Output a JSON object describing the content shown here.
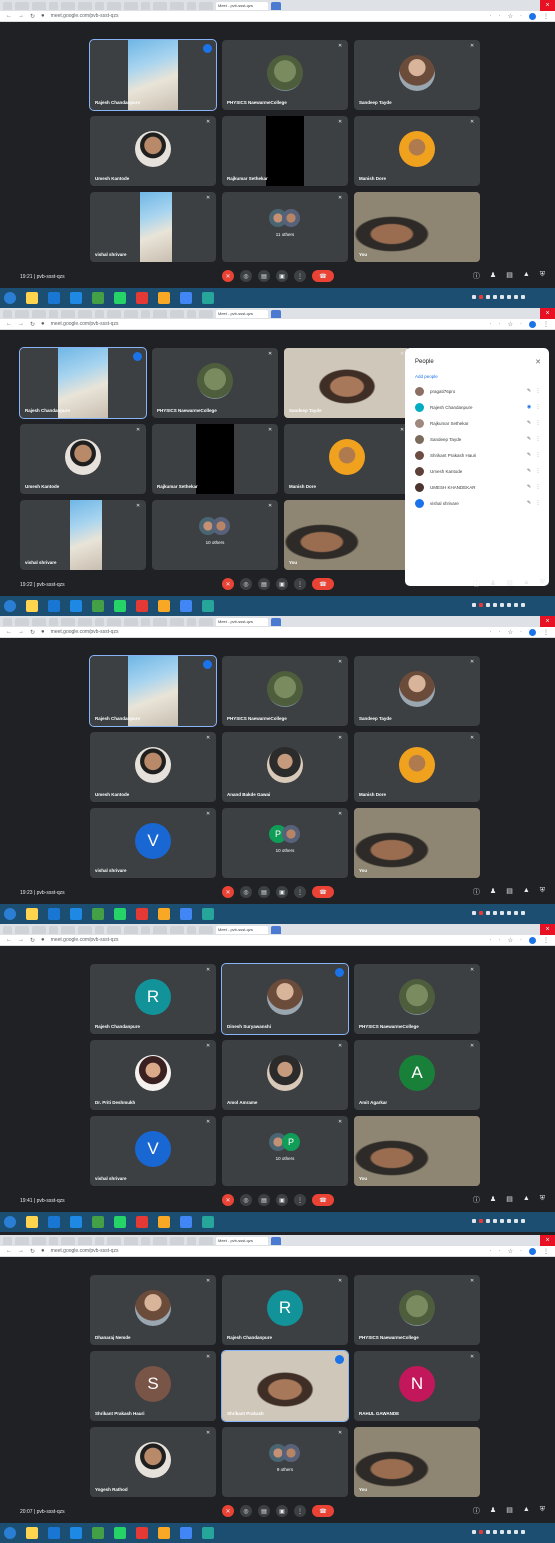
{
  "frames": [
    {
      "time_label": "19:21 | pvb-ssst-qzs",
      "tiles": [
        {
          "name": "Rajesh Chandanpure",
          "kind": "self"
        },
        {
          "name": "PHYSICS NaewarmeCollege",
          "kind": "tree"
        },
        {
          "name": "Sandeep Tayde",
          "kind": "photo"
        },
        {
          "name": "Umesh Kantode",
          "kind": "glasses"
        },
        {
          "name": "Rajkumar Sethekar",
          "kind": "black"
        },
        {
          "name": "Manish Dore",
          "kind": "orange"
        },
        {
          "name": "vishal shrivare",
          "kind": "face"
        },
        {
          "name": "11 others",
          "kind": "others"
        },
        {
          "name": "You",
          "kind": "pin"
        }
      ]
    },
    {
      "time_label": "19:22 | pvb-ssst-qzs",
      "tiles": [
        {
          "name": "Rajesh Chandanpure",
          "kind": "self"
        },
        {
          "name": "PHYSICS NaewarmeCollege",
          "kind": "tree"
        },
        {
          "name": "Sandeep Tayde",
          "kind": "face"
        },
        {
          "name": "Umesh Kantode",
          "kind": "glasses"
        },
        {
          "name": "Rajkumar Sethekar",
          "kind": "black"
        },
        {
          "name": "Manish Dore",
          "kind": "orange"
        },
        {
          "name": "vishal shrivare",
          "kind": "face"
        },
        {
          "name": "10 others",
          "kind": "others"
        },
        {
          "name": "You",
          "kind": "pin"
        }
      ],
      "people_panel": {
        "title": "People",
        "add_label": "Add people",
        "people": [
          {
            "name": "pragati76pro",
            "color": "#8d6e63"
          },
          {
            "name": "Rajesh Chandanpure",
            "color": "#00acc1"
          },
          {
            "name": "Rajkumar Sethekar",
            "color": "#a1887f"
          },
          {
            "name": "Sandeep Tayde",
            "color": "#7b6b5a"
          },
          {
            "name": "Shrikant Prakash Hauri",
            "color": "#6d4c41"
          },
          {
            "name": "Umesh Kantode",
            "color": "#5d4037"
          },
          {
            "name": "UMESH KHANDEKAR",
            "color": "#4e342e"
          },
          {
            "name": "vishal shrivare",
            "color": "#1a73e8"
          }
        ]
      }
    },
    {
      "time_label": "19:23 | pvb-ssst-qzs",
      "tiles": [
        {
          "name": "Rajesh Chandanpure",
          "kind": "self"
        },
        {
          "name": "PHYSICS NaewarmeCollege",
          "kind": "tree"
        },
        {
          "name": "Sandeep Tayde",
          "kind": "photo"
        },
        {
          "name": "Umesh Kantode",
          "kind": "glasses"
        },
        {
          "name": "Anand Bakde Gawai",
          "kind": "person2"
        },
        {
          "name": "Manish Dore",
          "kind": "orange"
        },
        {
          "name": "vishal shrivare",
          "kind": "letter",
          "letter": "V",
          "color": "#1967d2"
        },
        {
          "name": "10 others",
          "kind": "others",
          "first_letter": "P"
        },
        {
          "name": "You",
          "kind": "pin"
        }
      ]
    },
    {
      "time_label": "19:41 | pvb-ssst-qzs",
      "tiles": [
        {
          "name": "Rajesh Chandanpure",
          "kind": "letter",
          "letter": "R",
          "color": "#12939a"
        },
        {
          "name": "Dinesh Suryawanshi",
          "kind": "photo",
          "highlight": true
        },
        {
          "name": "PHYSICS NaewarmeCollege",
          "kind": "tree"
        },
        {
          "name": "Dr. Priti Deshmukh",
          "kind": "lady"
        },
        {
          "name": "Amol Amrame",
          "kind": "person2"
        },
        {
          "name": "Amit Agarkar",
          "kind": "letter",
          "letter": "A",
          "color": "#188038"
        },
        {
          "name": "vishal shrivare",
          "kind": "letter",
          "letter": "V",
          "color": "#1967d2"
        },
        {
          "name": "10 others",
          "kind": "others",
          "second_letter": "P"
        },
        {
          "name": "You",
          "kind": "pin"
        }
      ]
    },
    {
      "time_label": "20:07 | pvb-ssst-qzs",
      "tiles": [
        {
          "name": "Dhanaraj Nemde",
          "kind": "photo"
        },
        {
          "name": "Rajesh Chandanpure",
          "kind": "letter",
          "letter": "R",
          "color": "#12939a"
        },
        {
          "name": "PHYSICS NaewarmeCollege",
          "kind": "tree"
        },
        {
          "name": "Shrikant Prakash Hauri",
          "kind": "letter",
          "letter": "S",
          "color": "#795548"
        },
        {
          "name": "Shrikant Prakash",
          "kind": "face",
          "highlight": true
        },
        {
          "name": "RAHUL GAWANDE",
          "kind": "letter",
          "letter": "N",
          "color": "#c2185b"
        },
        {
          "name": "Yogesh Rathod",
          "kind": "glasses"
        },
        {
          "name": "9 others",
          "kind": "others"
        },
        {
          "name": "You",
          "kind": "pin"
        }
      ]
    }
  ],
  "browser": {
    "url": "meet.google.com/pvb-ssst-qzs",
    "active_tab": "Meet - pvb-ssst-qzs"
  },
  "colors": {
    "meet_bg": "#202124",
    "tile_bg": "#3c4043",
    "end_call": "#ea4335",
    "highlight": "#8ab4f8",
    "taskbar": "#1c4e72"
  }
}
